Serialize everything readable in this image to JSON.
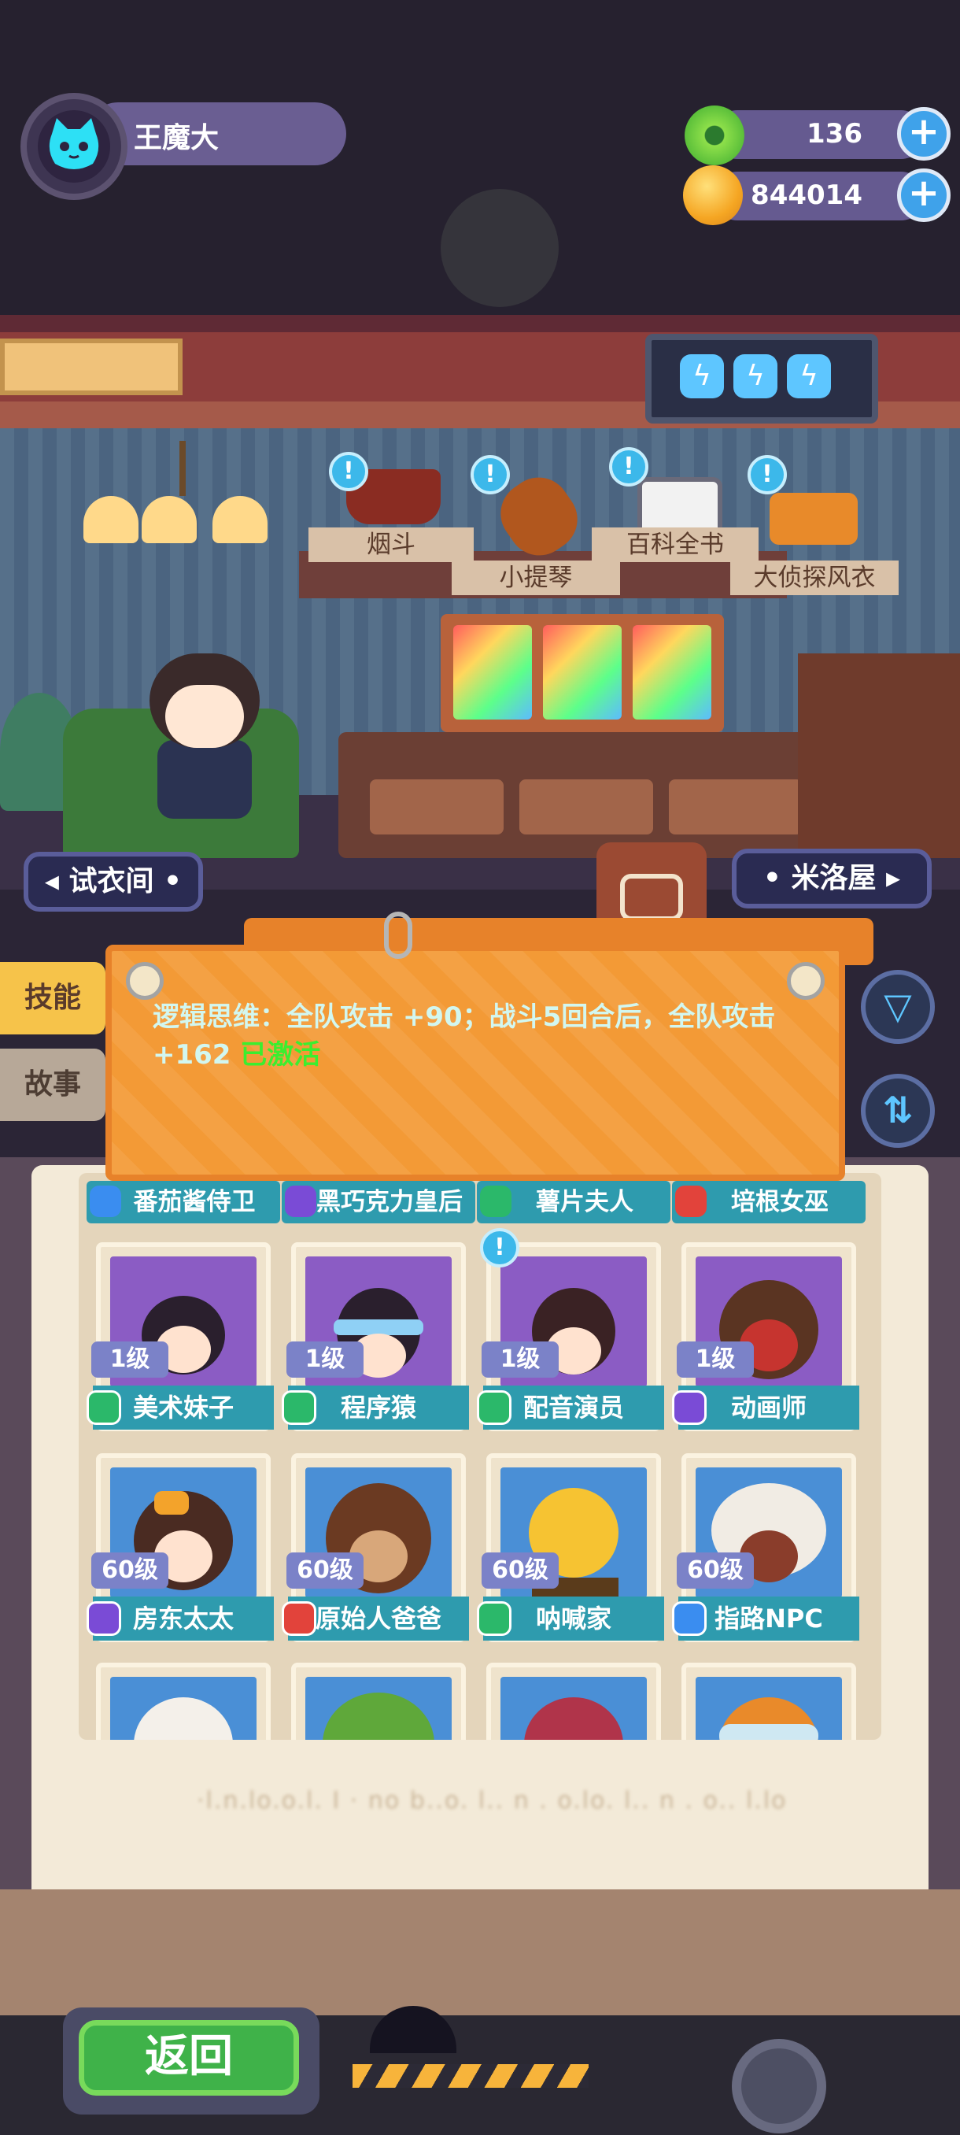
{
  "player": {
    "name": "王魔大"
  },
  "currencies": [
    {
      "icon": "green-gem-icon",
      "value": "136"
    },
    {
      "icon": "gold-planet-coin-icon",
      "value": "844014"
    }
  ],
  "plus_symbol": "+",
  "energy_symbol": "ϟ",
  "hint_symbol": "!",
  "room": {
    "items": [
      {
        "label": "烟斗",
        "icon": "pipe-icon"
      },
      {
        "label": "小提琴",
        "icon": "violin-icon"
      },
      {
        "label": "百科全书",
        "icon": "encyclopedia-icon"
      },
      {
        "label": "大侦探风衣",
        "icon": "trench-coat-icon"
      }
    ],
    "nav_left": "◂ 试衣间 •",
    "nav_right": "• 米洛屋 ▸"
  },
  "side_tabs": {
    "skills": "技能",
    "story": "故事"
  },
  "notice": {
    "skill_text": "逻辑思维：全队攻击 +90；战斗5回合后，全队攻击 +162",
    "status": " 已激活"
  },
  "round_buttons": {
    "filter_symbol": "▽",
    "sort_symbol": "⇅"
  },
  "colors": {
    "accent_teal": "#2e9bae",
    "active_green": "#3bee2f",
    "notice_orange": "#f39a36",
    "rarity_green": "#2bb86a",
    "rarity_purple": "#7a4bd6",
    "rarity_blue": "#3a8df0",
    "rarity_red": "#e2433b"
  },
  "book": {
    "headers": [
      {
        "name": "番茄酱侍卫",
        "rarity": "blue"
      },
      {
        "name": "黑巧克力皇后",
        "rarity": "purple"
      },
      {
        "name": "薯片夫人",
        "rarity": "green"
      },
      {
        "name": "培根女巫",
        "rarity": "red"
      }
    ],
    "rows": [
      [
        {
          "name": "美术妹子",
          "level": "1级",
          "rarity": "green"
        },
        {
          "name": "程序猿",
          "level": "1级",
          "rarity": "green"
        },
        {
          "name": "配音演员",
          "level": "1级",
          "rarity": "green"
        },
        {
          "name": "动画师",
          "level": "1级",
          "rarity": "purple"
        }
      ],
      [
        {
          "name": "房东太太",
          "level": "60级",
          "rarity": "purple"
        },
        {
          "name": "原始人爸爸",
          "level": "60级",
          "rarity": "red"
        },
        {
          "name": "呐喊家",
          "level": "60级",
          "rarity": "green"
        },
        {
          "name": "指路NPC",
          "level": "60级",
          "rarity": "blue"
        }
      ]
    ],
    "footer_blurred": "·l.n.lo.o.l. I · no    b..o. l.. n . o.lo. l.. n . o.. l.lo"
  },
  "bottom": {
    "back": "返回"
  }
}
